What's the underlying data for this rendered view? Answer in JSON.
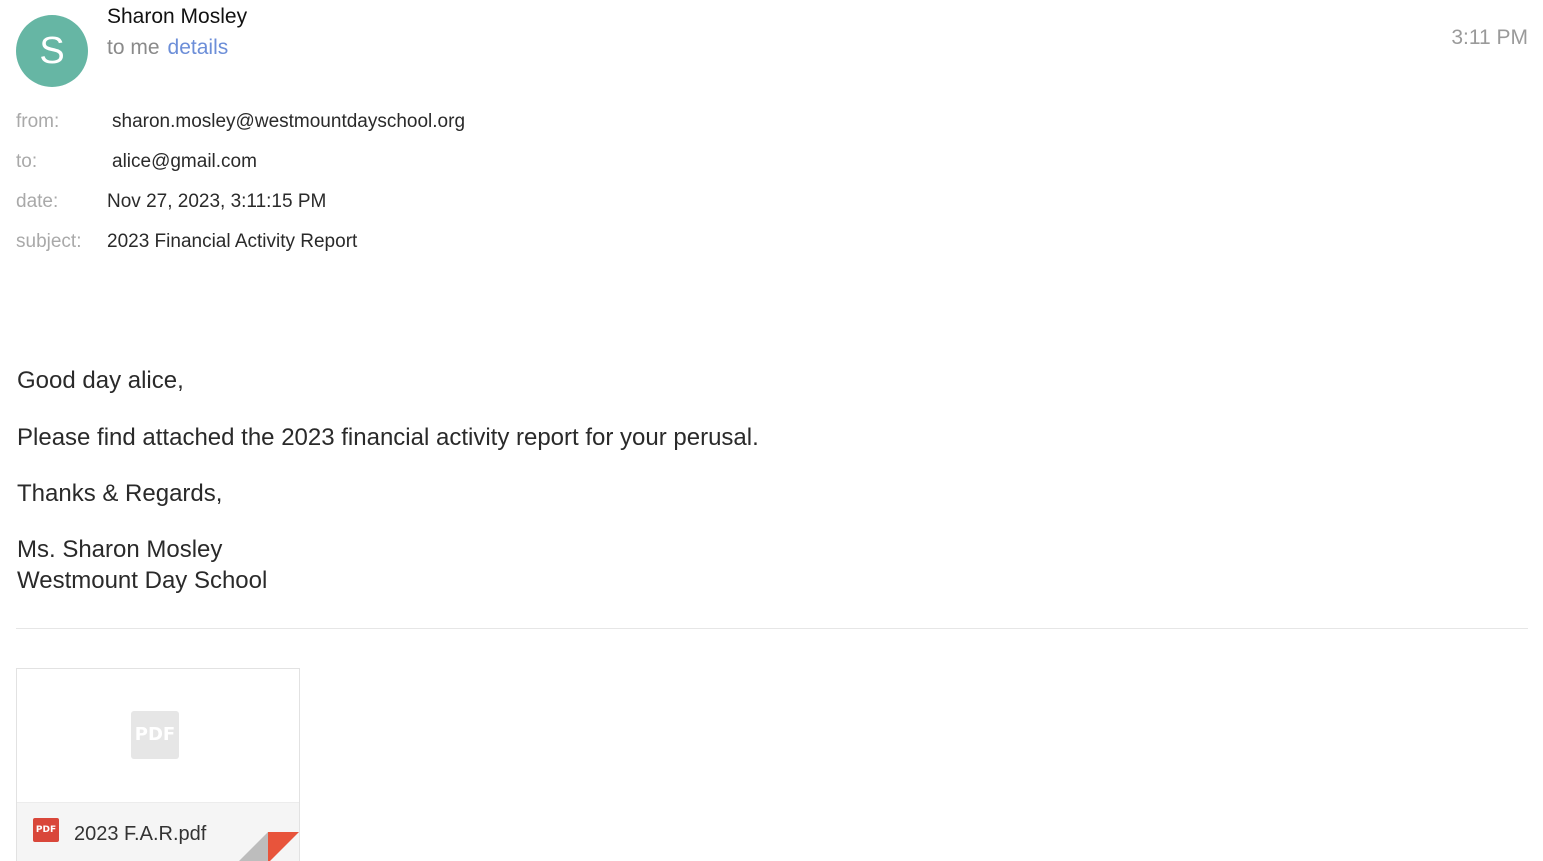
{
  "sender": {
    "initial": "S",
    "name": "Sharon Mosley",
    "to_text": "to me",
    "details_link": "details",
    "time": "3:11 PM",
    "avatar_color": "#66b6a4"
  },
  "meta": {
    "from_label": "from:",
    "from_value": "sharon.mosley@westmountdayschool.org",
    "to_label": "to:",
    "to_value": "alice@gmail.com",
    "date_label": "date:",
    "date_value": "Nov 27, 2023, 3:11:15 PM",
    "subject_label": "subject:",
    "subject_value": "2023 Financial Activity Report"
  },
  "body": {
    "greeting": "Good day alice,",
    "paragraph": "Please find attached the 2023 financial activity report for your perusal.",
    "closing": "Thanks & Regards,",
    "signature_name": "Ms. Sharon Mosley",
    "signature_org": "Westmount Day School"
  },
  "attachment": {
    "filename": "2023 F.A.R.pdf",
    "preview_icon_text": "PDF",
    "type_icon_text": "PDF",
    "type_icon": "pdf-icon",
    "accent_color": "#e8543b"
  }
}
